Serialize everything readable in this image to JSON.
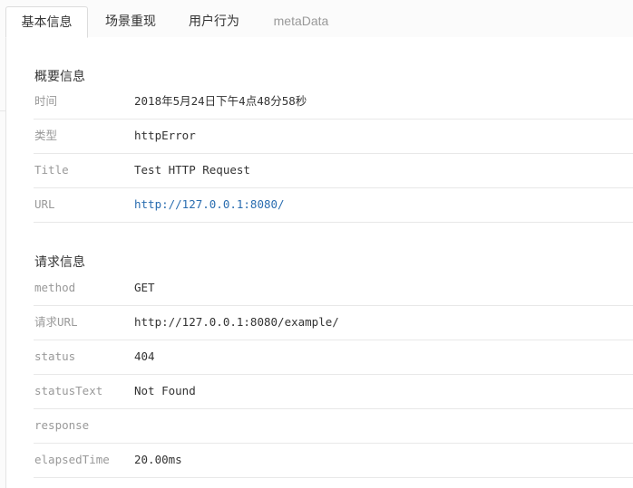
{
  "tabs": [
    {
      "label": "基本信息",
      "active": true
    },
    {
      "label": "场景重现",
      "active": false
    },
    {
      "label": "用户行为",
      "active": false
    },
    {
      "label": "metaData",
      "active": false
    }
  ],
  "overview": {
    "title": "概要信息",
    "rows": [
      {
        "label": "时间",
        "value": "2018年5月24日下午4点48分58秒"
      },
      {
        "label": "类型",
        "value": "httpError"
      },
      {
        "label": "Title",
        "value": "Test HTTP Request"
      },
      {
        "label": "URL",
        "value": "http://127.0.0.1:8080/"
      }
    ]
  },
  "request": {
    "title": "请求信息",
    "rows": [
      {
        "label": "method",
        "value": "GET"
      },
      {
        "label": "请求URL",
        "value": "http://127.0.0.1:8080/example/"
      },
      {
        "label": "status",
        "value": "404"
      },
      {
        "label": "statusText",
        "value": "Not Found"
      },
      {
        "label": "response",
        "value": ""
      },
      {
        "label": "elapsedTime",
        "value": "20.00ms"
      }
    ]
  },
  "colors": {
    "link": "#2a6db0",
    "label": "#999999",
    "text": "#333333"
  }
}
